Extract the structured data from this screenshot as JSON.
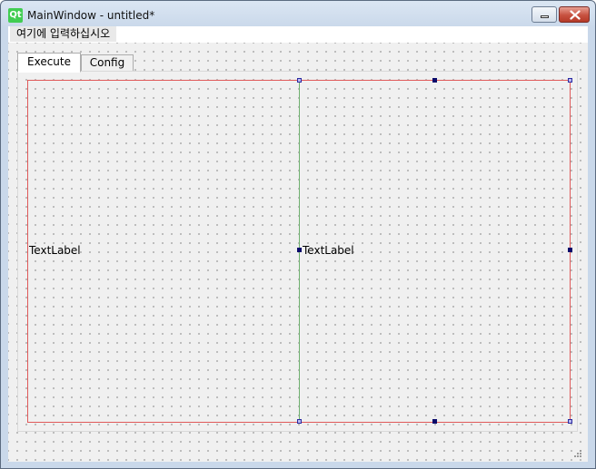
{
  "window": {
    "title": "MainWindow - untitled*",
    "app_icon_text": "Qt"
  },
  "menubar": {
    "placeholder_item": "여기에 입력하십시오"
  },
  "tabs": [
    {
      "label": "Execute",
      "selected": true
    },
    {
      "label": "Config",
      "selected": false
    }
  ],
  "labels": {
    "left": "TextLabel",
    "right": "TextLabel"
  },
  "colors": {
    "layout_frame": "#e05a5a",
    "splitter_line": "#6fb06f",
    "selection_handle": "#0a0a6a",
    "close_button": "#c75140",
    "qt_icon": "#41cd52"
  },
  "icons": [
    "qt-logo-icon",
    "minimize-icon",
    "close-icon",
    "size-grip-icon"
  ]
}
